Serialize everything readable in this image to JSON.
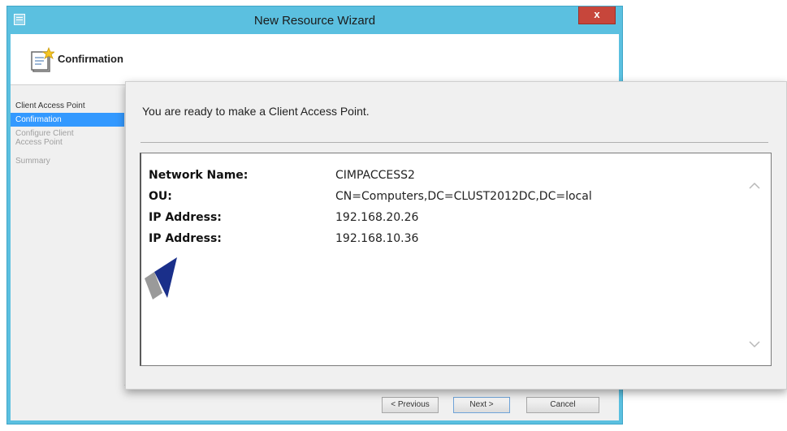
{
  "window": {
    "title": "New Resource Wizard",
    "close_label": "x"
  },
  "header": {
    "title": "Confirmation"
  },
  "steps": [
    {
      "label": "Client Access Point",
      "state": "normal"
    },
    {
      "label": "Confirmation",
      "state": "active"
    },
    {
      "label": "Configure Client Access Point",
      "state": "disabled"
    },
    {
      "label": "Summary",
      "state": "disabled"
    }
  ],
  "buttons": {
    "previous": "< Previous",
    "next": "Next >",
    "cancel": "Cancel"
  },
  "confirmation": {
    "message": "You are ready to make a Client Access Point.",
    "details": [
      {
        "key": "Network Name:",
        "value": "CIMPACCESS2"
      },
      {
        "key": "OU:",
        "value": "CN=Computers,DC=CLUST2012DC,DC=local"
      },
      {
        "key": "IP Address:",
        "value": "192.168.20.26"
      },
      {
        "key": "IP Address:",
        "value": "192.168.10.36"
      }
    ]
  },
  "colors": {
    "window_frame": "#5bc0e0",
    "close_button": "#c7463b",
    "active_step": "#3399ff",
    "pointer": "#1a2f8a"
  },
  "icons": {
    "title": "wizard-window-icon",
    "header": "confirmation-wizard-icon",
    "close": "close-icon",
    "scroll_up": "chevron-up-icon",
    "scroll_down": "chevron-down-icon",
    "pointer": "arrow-pointer-icon"
  }
}
